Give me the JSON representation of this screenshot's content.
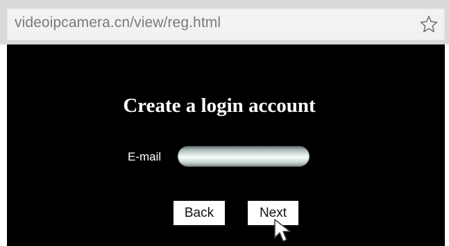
{
  "browser": {
    "url": "videoipcamera.cn/view/reg.html",
    "bookmark_icon": "star-outline-icon"
  },
  "page": {
    "title": "Create a login account",
    "email_label": "E-mail",
    "email_value": "",
    "back_label": "Back",
    "next_label": "Next",
    "cursor_icon": "mouse-pointer-icon"
  },
  "colors": {
    "chrome_band": "#d9d9d9",
    "address_bar": "#f2f2f2",
    "url_text": "#7a7a7a",
    "page_background": "#000000",
    "text": "#ffffff",
    "button_background": "#ffffff"
  }
}
